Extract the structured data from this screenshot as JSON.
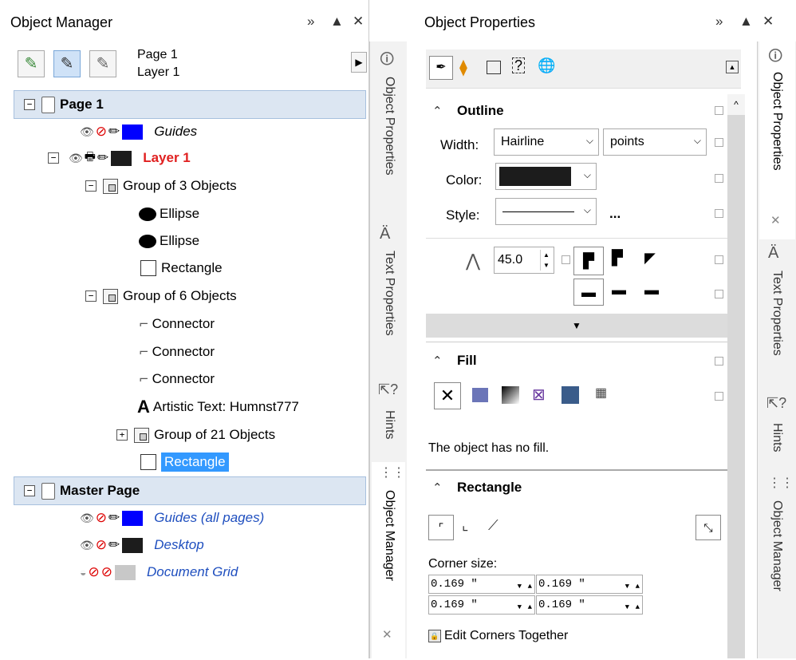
{
  "object_manager": {
    "title": "Object Manager",
    "page_label": "Page 1",
    "layer_label": "Layer 1",
    "tree": {
      "page1": "Page 1",
      "guides": "Guides",
      "layer1": "Layer 1",
      "group3": "Group of 3 Objects",
      "ellipse1": "Ellipse",
      "ellipse2": "Ellipse",
      "rect1": "Rectangle",
      "group6": "Group of 6 Objects",
      "conn1": "Connector",
      "conn2": "Connector",
      "conn3": "Connector",
      "text": "Artistic Text: Humnst777",
      "group21": "Group of 21 Objects",
      "rect2": "Rectangle",
      "master": "Master Page",
      "guides_all": "Guides (all pages)",
      "desktop": "Desktop",
      "docgrid": "Document Grid"
    }
  },
  "side_tabs_left": [
    "Object Properties",
    "Text Properties",
    "Hints",
    "Object Manager"
  ],
  "side_tabs_right": [
    "Object Properties",
    "Text Properties",
    "Hints",
    "Object Manager"
  ],
  "object_properties": {
    "title": "Object Properties",
    "outline": {
      "title": "Outline",
      "width_label": "Width:",
      "width_value": "Hairline",
      "units_value": "points",
      "color_label": "Color:",
      "style_label": "Style:",
      "ellipsis": "...",
      "miter_value": "45.0"
    },
    "fill": {
      "title": "Fill",
      "no_fill_text": "The object has no fill."
    },
    "rectangle": {
      "title": "Rectangle",
      "corner_size_label": "Corner size:",
      "corner_tl": "0.169 \"",
      "corner_tr": "0.169 \"",
      "corner_bl": "0.169 \"",
      "corner_br": "0.169 \"",
      "edit_together": "Edit Corners Together"
    }
  },
  "colors": {
    "selection": "#3399ff",
    "layer_red": "#e02020",
    "italic_blue": "#1f4fbf",
    "header_bg": "#dce6f2"
  }
}
